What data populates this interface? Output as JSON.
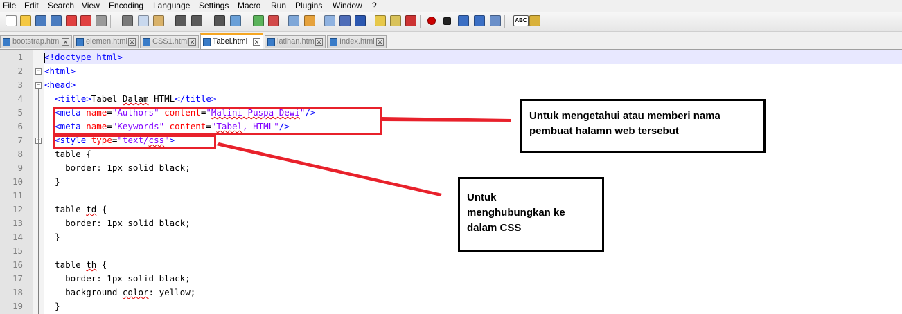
{
  "menu": [
    "File",
    "Edit",
    "Search",
    "View",
    "Encoding",
    "Language",
    "Settings",
    "Macro",
    "Run",
    "Plugins",
    "Window",
    "?"
  ],
  "toolbar": {
    "icons": [
      "new-file-icon",
      "open-file-icon",
      "save-icon",
      "save-all-icon",
      "close-icon",
      "close-all-icon",
      "print-icon",
      "cut-icon",
      "copy-icon",
      "paste-icon",
      "undo-icon",
      "redo-icon",
      "find-icon",
      "replace-icon",
      "zoom-in-icon",
      "zoom-out-icon",
      "sync-vertical-icon",
      "sync-horizontal-icon",
      "word-wrap-icon",
      "show-all-chars-icon",
      "indent-guide-icon",
      "user-language-icon",
      "doc-map-icon",
      "function-list-icon",
      "record-macro-icon",
      "stop-record-icon",
      "play-macro-icon",
      "run-macro-multiple-icon",
      "save-macro-icon",
      "spell-check-icon",
      "spell-check-options-icon"
    ],
    "spell_label": "ABC"
  },
  "tabs": [
    {
      "label": "bootstrap.html",
      "active": false
    },
    {
      "label": "elemen.html",
      "active": false
    },
    {
      "label": "CSS1.html",
      "active": false
    },
    {
      "label": "Tabel.html",
      "active": true
    },
    {
      "label": "latihan.html",
      "active": false
    },
    {
      "label": "Index.html",
      "active": false
    }
  ],
  "editor": {
    "line_numbers": [
      "1",
      "2",
      "3",
      "4",
      "5",
      "6",
      "7",
      "8",
      "9",
      "10",
      "11",
      "12",
      "13",
      "14",
      "15",
      "16",
      "17",
      "18",
      "19"
    ],
    "lines": [
      [
        [
          "tag",
          "<!doctype html>"
        ]
      ],
      [
        [
          "tag",
          "<html>"
        ]
      ],
      [
        [
          "tag",
          "<head>"
        ]
      ],
      [
        [
          "txt",
          "  "
        ],
        [
          "tag",
          "<title>"
        ],
        [
          "txt",
          "Tabel "
        ],
        [
          "sq",
          "Dalam"
        ],
        [
          "txt",
          " HTML"
        ],
        [
          "tag",
          "</title>"
        ]
      ],
      [
        [
          "txt",
          "  "
        ],
        [
          "tag",
          "<meta "
        ],
        [
          "attr",
          "name"
        ],
        [
          "txt",
          "="
        ],
        [
          "str",
          "\"Authors\""
        ],
        [
          "txt",
          " "
        ],
        [
          "attr",
          "content"
        ],
        [
          "txt",
          "="
        ],
        [
          "str",
          "\""
        ],
        [
          "strsq",
          "Malini Puspa Dewi"
        ],
        [
          "str",
          "\""
        ],
        [
          "tag",
          "/>"
        ]
      ],
      [
        [
          "txt",
          "  "
        ],
        [
          "tag",
          "<meta "
        ],
        [
          "attr",
          "name"
        ],
        [
          "txt",
          "="
        ],
        [
          "str",
          "\"Keywords\""
        ],
        [
          "txt",
          " "
        ],
        [
          "attr",
          "content"
        ],
        [
          "txt",
          "="
        ],
        [
          "str",
          "\""
        ],
        [
          "strsq",
          "Tabel"
        ],
        [
          "str",
          ", HTML\""
        ],
        [
          "tag",
          "/>"
        ]
      ],
      [
        [
          "txt",
          "  "
        ],
        [
          "tag",
          "<style "
        ],
        [
          "attr",
          "type"
        ],
        [
          "txt",
          "="
        ],
        [
          "str",
          "\"text/"
        ],
        [
          "strsq",
          "css"
        ],
        [
          "str",
          "\""
        ],
        [
          "tag",
          ">"
        ]
      ],
      [
        [
          "txt",
          "  table {"
        ]
      ],
      [
        [
          "txt",
          "    border: 1px solid black;"
        ]
      ],
      [
        [
          "txt",
          "  }"
        ]
      ],
      [
        [
          "txt",
          ""
        ]
      ],
      [
        [
          "txt",
          "  table "
        ],
        [
          "sq",
          "td"
        ],
        [
          "txt",
          " {"
        ]
      ],
      [
        [
          "txt",
          "    border: 1px solid black;"
        ]
      ],
      [
        [
          "txt",
          "  }"
        ]
      ],
      [
        [
          "txt",
          ""
        ]
      ],
      [
        [
          "txt",
          "  table "
        ],
        [
          "sq",
          "th"
        ],
        [
          "txt",
          " {"
        ]
      ],
      [
        [
          "txt",
          "    border: 1px solid black;"
        ]
      ],
      [
        [
          "txt",
          "    background-"
        ],
        [
          "sq",
          "color"
        ],
        [
          "txt",
          ": yellow;"
        ]
      ],
      [
        [
          "txt",
          "  }"
        ]
      ]
    ]
  },
  "annotations": {
    "meta_note": "Untuk mengetahui atau memberi nama pembuat halamn web tersebut",
    "style_note_line1": "Untuk",
    "style_note_line2": "menghubungkan ke",
    "style_note_line3": "dalam CSS",
    "highlight_color": "#e8212b"
  }
}
